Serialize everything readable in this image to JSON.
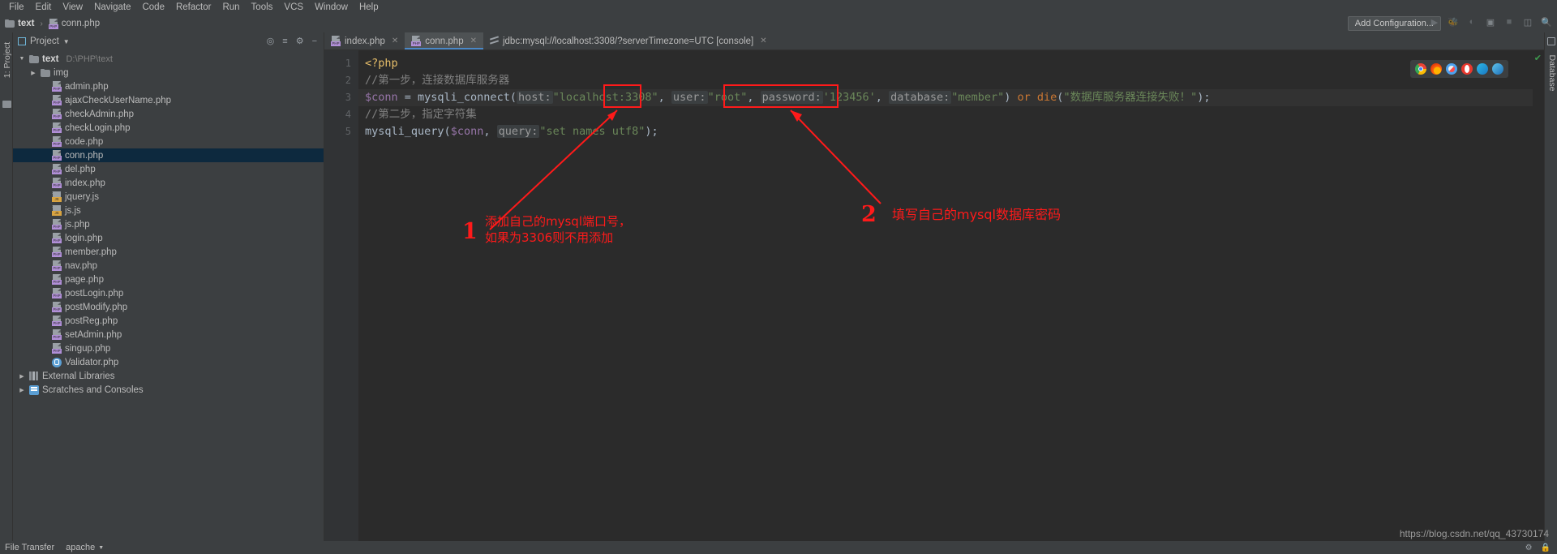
{
  "menubar": {
    "items": [
      "File",
      "Edit",
      "View",
      "Navigate",
      "Code",
      "Refactor",
      "Run",
      "Tools",
      "VCS",
      "Window",
      "Help"
    ]
  },
  "navbar": {
    "crumb_project": "text",
    "crumb_separator": "›",
    "crumb_file": "conn.php",
    "add_configuration": "Add Configuration...",
    "icons": [
      "run-icon",
      "debug-icon",
      "run-coverage-icon",
      "profile-icon",
      "stop-icon",
      "layout-icon",
      "search-icon"
    ]
  },
  "project_panel": {
    "title": "Project",
    "tool_icons": [
      "target-icon",
      "collapse-all-icon",
      "settings-icon",
      "hide-icon"
    ],
    "tree": [
      {
        "label": "text",
        "path": "D:\\PHP\\text",
        "icon": "folder-icon",
        "arrow": "▼",
        "depth": 0,
        "bold": true,
        "selected": false
      },
      {
        "label": "img",
        "path": "",
        "icon": "folder-icon",
        "arrow": "▶",
        "depth": 1,
        "bold": false,
        "selected": false
      },
      {
        "label": "admin.php",
        "path": "",
        "icon": "php-icon",
        "arrow": "",
        "depth": 2,
        "bold": false,
        "selected": false
      },
      {
        "label": "ajaxCheckUserName.php",
        "path": "",
        "icon": "php-icon",
        "arrow": "",
        "depth": 2,
        "bold": false,
        "selected": false
      },
      {
        "label": "checkAdmin.php",
        "path": "",
        "icon": "php-icon",
        "arrow": "",
        "depth": 2,
        "bold": false,
        "selected": false
      },
      {
        "label": "checkLogin.php",
        "path": "",
        "icon": "php-icon",
        "arrow": "",
        "depth": 2,
        "bold": false,
        "selected": false
      },
      {
        "label": "code.php",
        "path": "",
        "icon": "php-icon",
        "arrow": "",
        "depth": 2,
        "bold": false,
        "selected": false
      },
      {
        "label": "conn.php",
        "path": "",
        "icon": "php-icon",
        "arrow": "",
        "depth": 2,
        "bold": false,
        "selected": true
      },
      {
        "label": "del.php",
        "path": "",
        "icon": "php-icon",
        "arrow": "",
        "depth": 2,
        "bold": false,
        "selected": false
      },
      {
        "label": "index.php",
        "path": "",
        "icon": "php-icon",
        "arrow": "",
        "depth": 2,
        "bold": false,
        "selected": false
      },
      {
        "label": "jquery.js",
        "path": "",
        "icon": "js-icon",
        "arrow": "",
        "depth": 2,
        "bold": false,
        "selected": false
      },
      {
        "label": "js.js",
        "path": "",
        "icon": "js-icon",
        "arrow": "",
        "depth": 2,
        "bold": false,
        "selected": false
      },
      {
        "label": "js.php",
        "path": "",
        "icon": "php-icon",
        "arrow": "",
        "depth": 2,
        "bold": false,
        "selected": false
      },
      {
        "label": "login.php",
        "path": "",
        "icon": "php-icon",
        "arrow": "",
        "depth": 2,
        "bold": false,
        "selected": false
      },
      {
        "label": "member.php",
        "path": "",
        "icon": "php-icon",
        "arrow": "",
        "depth": 2,
        "bold": false,
        "selected": false
      },
      {
        "label": "nav.php",
        "path": "",
        "icon": "php-icon",
        "arrow": "",
        "depth": 2,
        "bold": false,
        "selected": false
      },
      {
        "label": "page.php",
        "path": "",
        "icon": "php-icon",
        "arrow": "",
        "depth": 2,
        "bold": false,
        "selected": false
      },
      {
        "label": "postLogin.php",
        "path": "",
        "icon": "php-icon",
        "arrow": "",
        "depth": 2,
        "bold": false,
        "selected": false
      },
      {
        "label": "postModify.php",
        "path": "",
        "icon": "php-icon",
        "arrow": "",
        "depth": 2,
        "bold": false,
        "selected": false
      },
      {
        "label": "postReg.php",
        "path": "",
        "icon": "php-icon",
        "arrow": "",
        "depth": 2,
        "bold": false,
        "selected": false
      },
      {
        "label": "setAdmin.php",
        "path": "",
        "icon": "php-icon",
        "arrow": "",
        "depth": 2,
        "bold": false,
        "selected": false
      },
      {
        "label": "singup.php",
        "path": "",
        "icon": "php-icon",
        "arrow": "",
        "depth": 2,
        "bold": false,
        "selected": false
      },
      {
        "label": "Validator.php",
        "path": "",
        "icon": "validator-icon",
        "arrow": "",
        "depth": 2,
        "bold": false,
        "selected": false
      },
      {
        "label": "External Libraries",
        "path": "",
        "icon": "library-icon",
        "arrow": "▶",
        "depth": 0,
        "bold": false,
        "selected": false
      },
      {
        "label": "Scratches and Consoles",
        "path": "",
        "icon": "scratches-icon",
        "arrow": "▶",
        "depth": 0,
        "bold": false,
        "selected": false
      }
    ]
  },
  "left_strip": {
    "tool_window": "1: Project"
  },
  "right_strip": {
    "tool_window": "Database"
  },
  "editor": {
    "tabs": [
      {
        "label": "index.php",
        "icon": "php-icon",
        "active": false,
        "closable": true
      },
      {
        "label": "conn.php",
        "icon": "php-icon",
        "active": true,
        "closable": true
      },
      {
        "label": "jdbc:mysql://localhost:3308/?serverTimezone=UTC [console]",
        "icon": "database-console-icon",
        "active": false,
        "closable": true
      }
    ],
    "line_numbers": [
      "1",
      "2",
      "3",
      "4",
      "5"
    ],
    "inspection_status": "✔",
    "lines": [
      {
        "n": 1,
        "text": "<?php"
      },
      {
        "n": 2,
        "text": "//第一步，连接数据库服务器"
      },
      {
        "n": 3,
        "text": "$conn = mysqli_connect( host: \"localhost:3308\", user: \"root\", password: '123456', database: \"member\") or die(\"数据库服务器连接失败！\");"
      },
      {
        "n": 4,
        "text": "//第二步，指定字符集"
      },
      {
        "n": 5,
        "text": "mysqli_query($conn, query: \"set names utf8\");"
      }
    ],
    "line3_tokens": {
      "var": "$conn",
      "eq": " = ",
      "fn": "mysqli_connect",
      "paren_open": "(",
      "hint_host": "host:",
      "str_host": "\"localhost:3308\"",
      "comma1": ", ",
      "hint_user": "user:",
      "str_user": "\"root\"",
      "comma2": ", ",
      "hint_password": "password:",
      "str_password": "'123456'",
      "comma3": ", ",
      "hint_database": "database:",
      "str_database": "\"member\"",
      "paren_close": ")",
      "or": " or ",
      "die": "die",
      "die_open": "(",
      "die_str": "\"数据库服务器连接失败！\"",
      "die_close": ");"
    },
    "line5_tokens": {
      "fn": "mysqli_query",
      "paren_open": "(",
      "var": "$conn",
      "comma": ", ",
      "hint_query": "query:",
      "str": "\"set names utf8\"",
      "paren_close": ");"
    }
  },
  "browsers": {
    "icons": [
      "chrome-icon",
      "firefox-icon",
      "safari-icon",
      "opera-icon",
      "edge-icon",
      "ie-icon"
    ]
  },
  "annotations": {
    "accent_color": "#ff1a1a",
    "items": [
      {
        "number": "1",
        "text": "添加自己的mysql端口号，\n如果为3306则不用添加"
      },
      {
        "number": "2",
        "text": "填写自己的mysql数据库密码"
      }
    ]
  },
  "watermark": "https://blog.csdn.net/qq_43730174",
  "status_bar": {
    "file_transfer": "File Transfer",
    "apache": "apache",
    "caret": "▼",
    "right_icons": [
      "gear-icon",
      "lock-icon"
    ]
  }
}
